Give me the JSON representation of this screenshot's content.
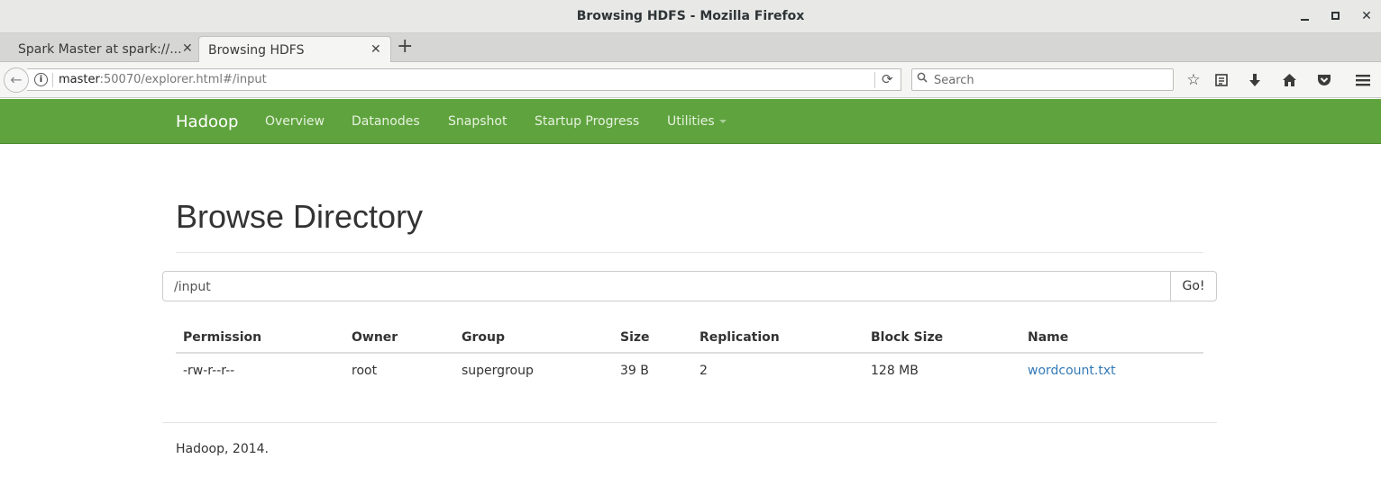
{
  "window": {
    "title": "Browsing HDFS - Mozilla Firefox"
  },
  "tabs": [
    {
      "label": "Spark Master at spark://..."
    },
    {
      "label": "Browsing HDFS"
    }
  ],
  "navbar": {
    "url_host": "master",
    "url_rest": ":50070/explorer.html#/input",
    "search_placeholder": "Search"
  },
  "hadoop_nav": {
    "brand": "Hadoop",
    "links": [
      {
        "label": "Overview"
      },
      {
        "label": "Datanodes"
      },
      {
        "label": "Snapshot"
      },
      {
        "label": "Startup Progress"
      },
      {
        "label": "Utilities"
      }
    ]
  },
  "page": {
    "title": "Browse Directory",
    "path_value": "/input",
    "go_label": "Go!"
  },
  "table": {
    "headers": [
      "Permission",
      "Owner",
      "Group",
      "Size",
      "Replication",
      "Block Size",
      "Name"
    ],
    "rows": [
      [
        "-rw-r--r--",
        "root",
        "supergroup",
        "39 B",
        "2",
        "128 MB",
        "wordcount.txt"
      ]
    ]
  },
  "footer": {
    "text": "Hadoop, 2014."
  },
  "colors": {
    "navbar_green": "#5fa33e",
    "link_blue": "#337ab7"
  }
}
